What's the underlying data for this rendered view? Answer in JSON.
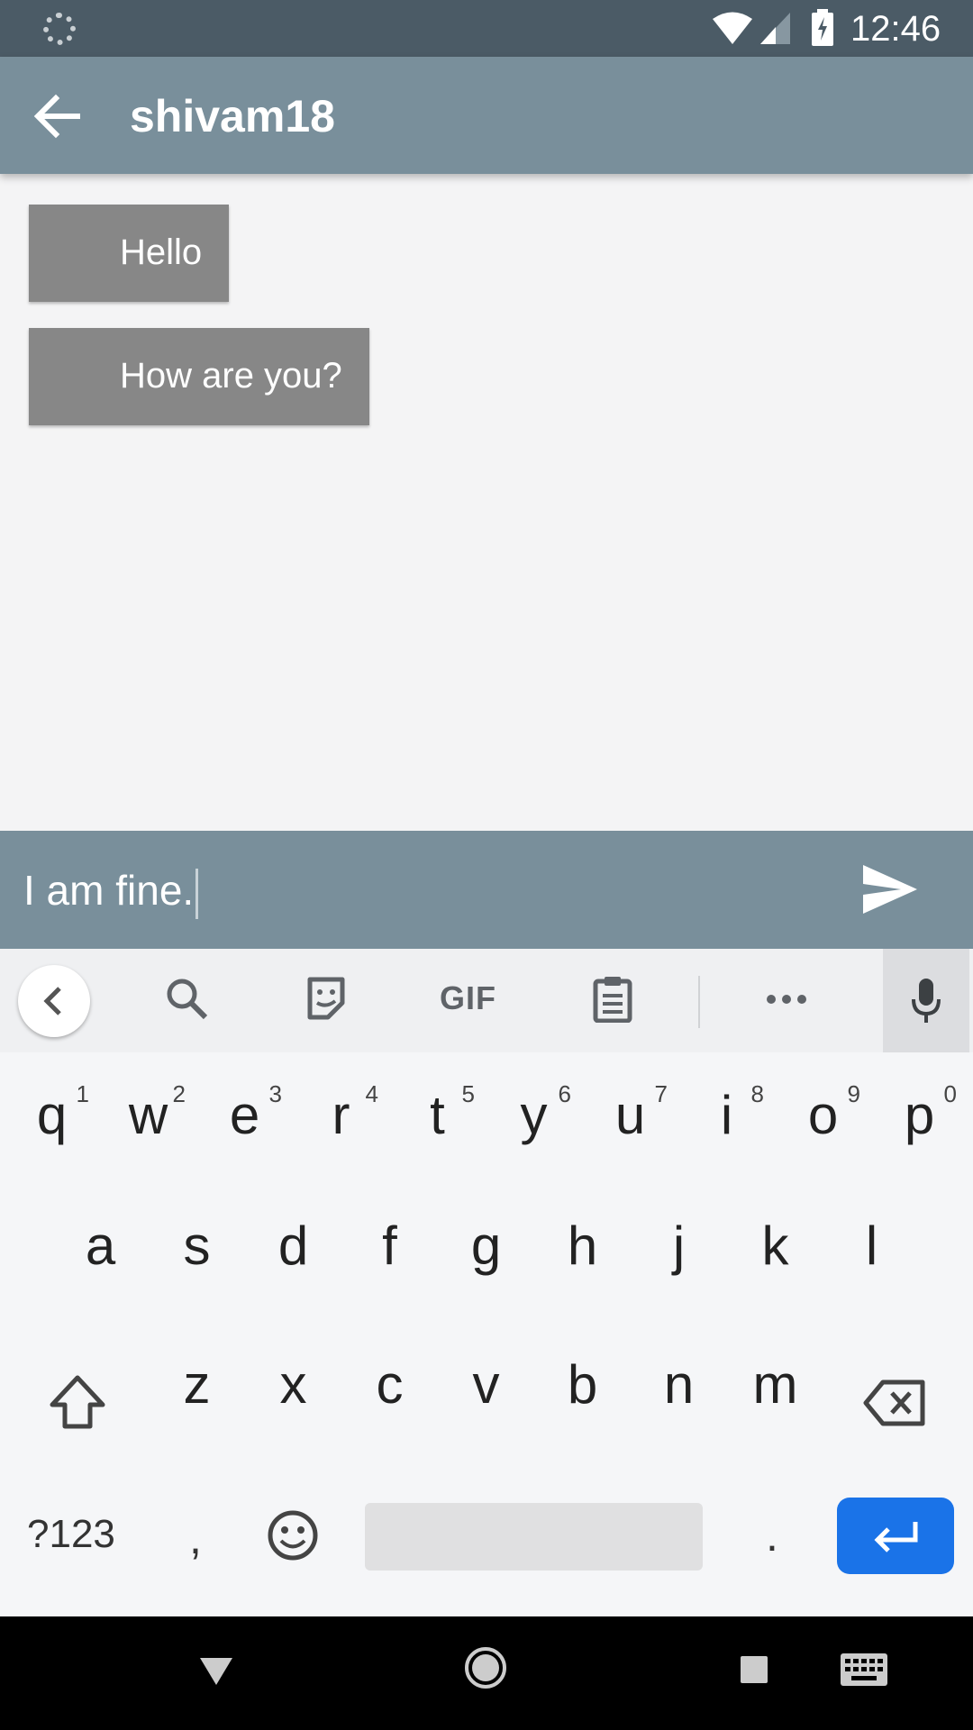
{
  "status_bar": {
    "time": "12:46"
  },
  "app_bar": {
    "title": "shivam18"
  },
  "messages": [
    {
      "text": "Hello"
    },
    {
      "text": "How are you?"
    }
  ],
  "composer": {
    "text": "I am fine."
  },
  "keyboard": {
    "toolbar": [
      "search",
      "sticker",
      "GIF",
      "clipboard",
      "more",
      "mic"
    ],
    "gif_label": "GIF",
    "row1": [
      {
        "ch": "q",
        "num": "1"
      },
      {
        "ch": "w",
        "num": "2"
      },
      {
        "ch": "e",
        "num": "3"
      },
      {
        "ch": "r",
        "num": "4"
      },
      {
        "ch": "t",
        "num": "5"
      },
      {
        "ch": "y",
        "num": "6"
      },
      {
        "ch": "u",
        "num": "7"
      },
      {
        "ch": "i",
        "num": "8"
      },
      {
        "ch": "o",
        "num": "9"
      },
      {
        "ch": "p",
        "num": "0"
      }
    ],
    "row2": [
      "a",
      "s",
      "d",
      "f",
      "g",
      "h",
      "j",
      "k",
      "l"
    ],
    "row3": [
      "z",
      "x",
      "c",
      "v",
      "b",
      "n",
      "m"
    ],
    "symbols_label": "?123",
    "comma": ",",
    "period": ".",
    "enter_color": "#1a73e8"
  }
}
